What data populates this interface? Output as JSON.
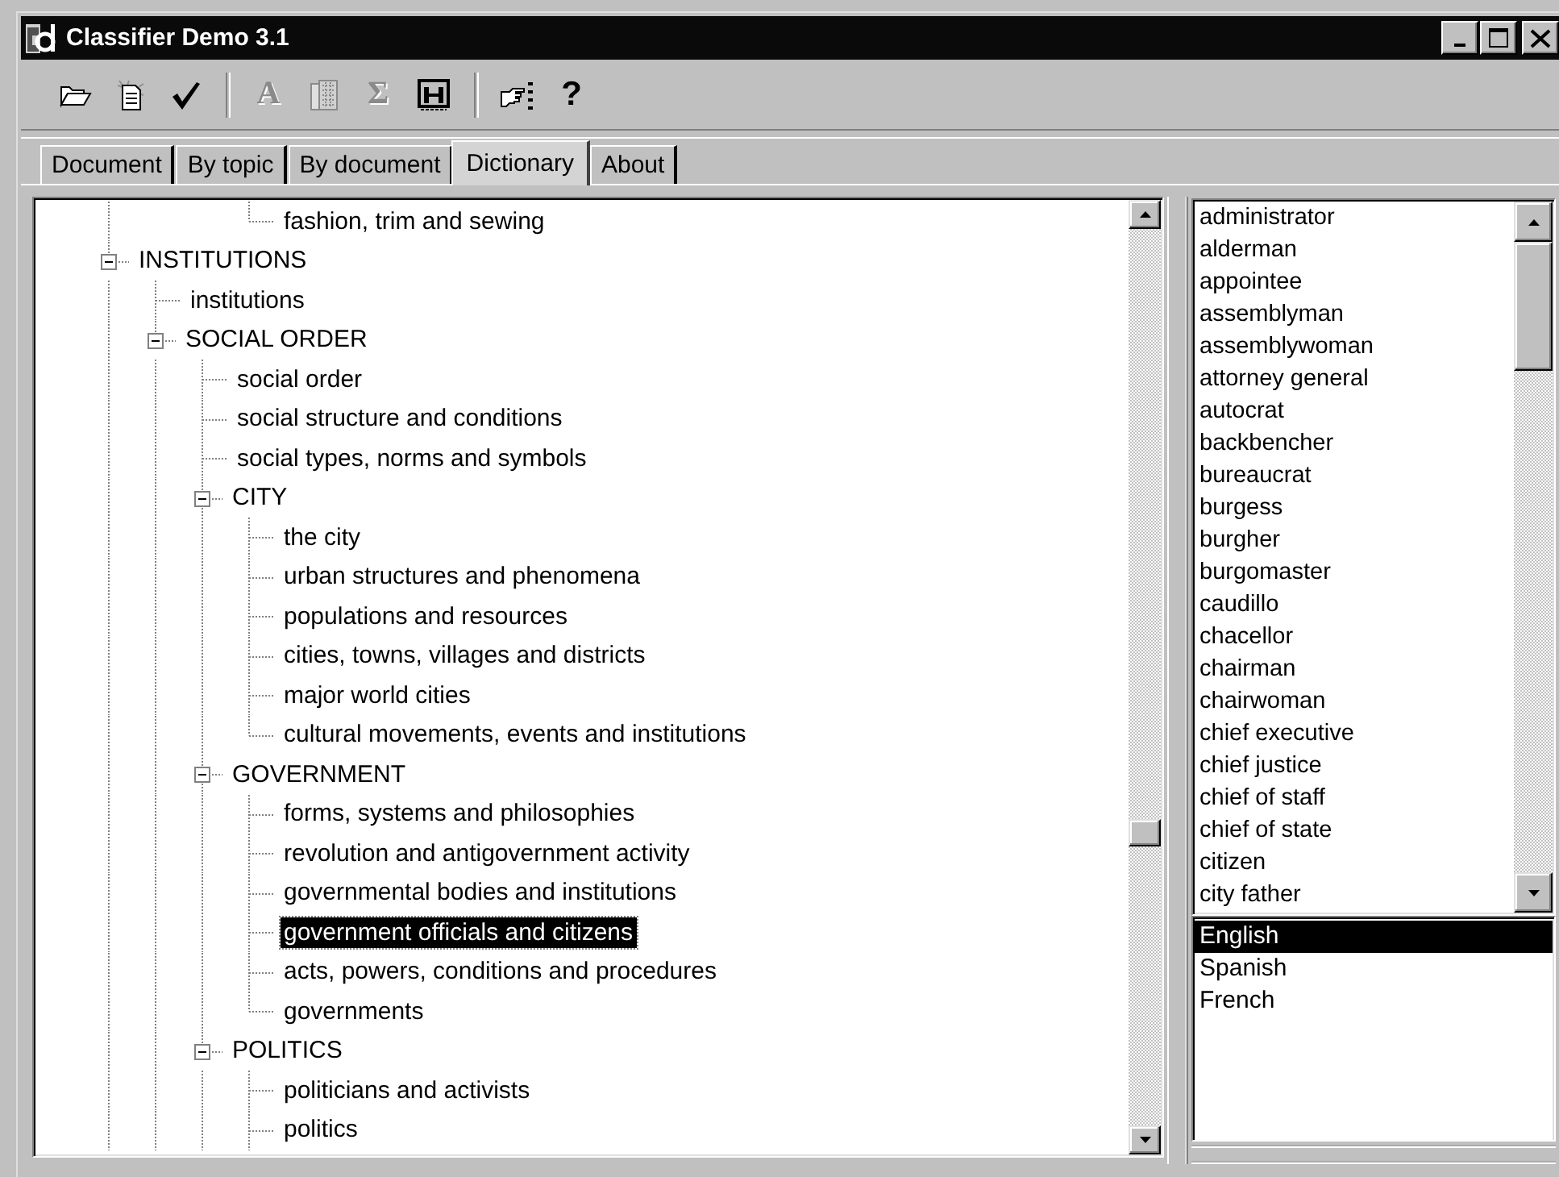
{
  "window": {
    "title": "Classifier Demo 3.1"
  },
  "toolbar": [
    {
      "buttons": [
        {
          "disabled": false
        },
        {
          "disabled": false
        },
        {
          "disabled": false
        }
      ]
    },
    {
      "buttons": [
        {
          "glyph": "A",
          "disabled": true
        },
        {
          "disabled": true
        },
        {
          "glyph": "Σ",
          "disabled": true
        },
        {
          "disabled": false
        }
      ]
    },
    {
      "buttons": [
        {
          "disabled": false
        },
        {
          "glyph": "?",
          "disabled": false
        }
      ]
    }
  ],
  "tabs": [
    {
      "label": "Document",
      "selected": false
    },
    {
      "label": "By topic",
      "selected": false
    },
    {
      "label": "By document",
      "selected": false
    },
    {
      "label": "Dictionary",
      "selected": true
    },
    {
      "label": "About",
      "selected": false
    }
  ],
  "tree": {
    "items": [
      {
        "children": [
          {
            "children": [
              {
                "children": [
                  {
                    "label": "fashion, trim and sewing",
                    "selected": false
                  }
                ]
              }
            ]
          }
        ]
      },
      {
        "label": "INSTITUTIONS",
        "expanded": true,
        "selected": false,
        "children": [
          {
            "label": "institutions",
            "selected": false
          },
          {
            "label": "SOCIAL ORDER",
            "expanded": true,
            "selected": false,
            "children": [
              {
                "label": "social order",
                "selected": false
              },
              {
                "label": "social structure and conditions",
                "selected": false
              },
              {
                "label": "social types, norms and symbols",
                "selected": false
              },
              {
                "label": "CITY",
                "expanded": true,
                "selected": false,
                "children": [
                  {
                    "label": "the city",
                    "selected": false
                  },
                  {
                    "label": "urban structures and phenomena",
                    "selected": false
                  },
                  {
                    "label": "populations and resources",
                    "selected": false
                  },
                  {
                    "label": "cities, towns, villages and districts",
                    "selected": false
                  },
                  {
                    "label": "major world cities",
                    "selected": false
                  },
                  {
                    "label": "cultural movements, events and institutions",
                    "selected": false
                  }
                ]
              },
              {
                "label": "GOVERNMENT",
                "expanded": true,
                "selected": false,
                "children": [
                  {
                    "label": "forms, systems and philosophies",
                    "selected": false
                  },
                  {
                    "label": "revolution and antigovernment activity",
                    "selected": false
                  },
                  {
                    "label": "governmental bodies and institutions",
                    "selected": false
                  },
                  {
                    "label": "government officials and citizens",
                    "selected": true
                  },
                  {
                    "label": "acts, powers, conditions and procedures",
                    "selected": false
                  },
                  {
                    "label": "governments",
                    "selected": false
                  }
                ]
              },
              {
                "label": "POLITICS",
                "expanded": true,
                "selected": false,
                "children": [
                  {
                    "label": "politicians and activists",
                    "selected": false
                  },
                  {
                    "label": "politics",
                    "selected": false
                  }
                ]
              }
            ]
          }
        ]
      }
    ]
  },
  "word_list": {
    "items": [
      "administrator",
      "alderman",
      "appointee",
      "assemblyman",
      "assemblywoman",
      "attorney general",
      "autocrat",
      "backbencher",
      "bureaucrat",
      "burgess",
      "burgher",
      "burgomaster",
      "caudillo",
      "chacellor",
      "chairman",
      "chairwoman",
      "chief executive",
      "chief justice",
      "chief of staff",
      "chief of state",
      "citizen",
      "city father"
    ]
  },
  "languages": [
    {
      "label": "English",
      "selected": true
    },
    {
      "label": "Spanish",
      "selected": false
    },
    {
      "label": "French",
      "selected": false
    }
  ]
}
